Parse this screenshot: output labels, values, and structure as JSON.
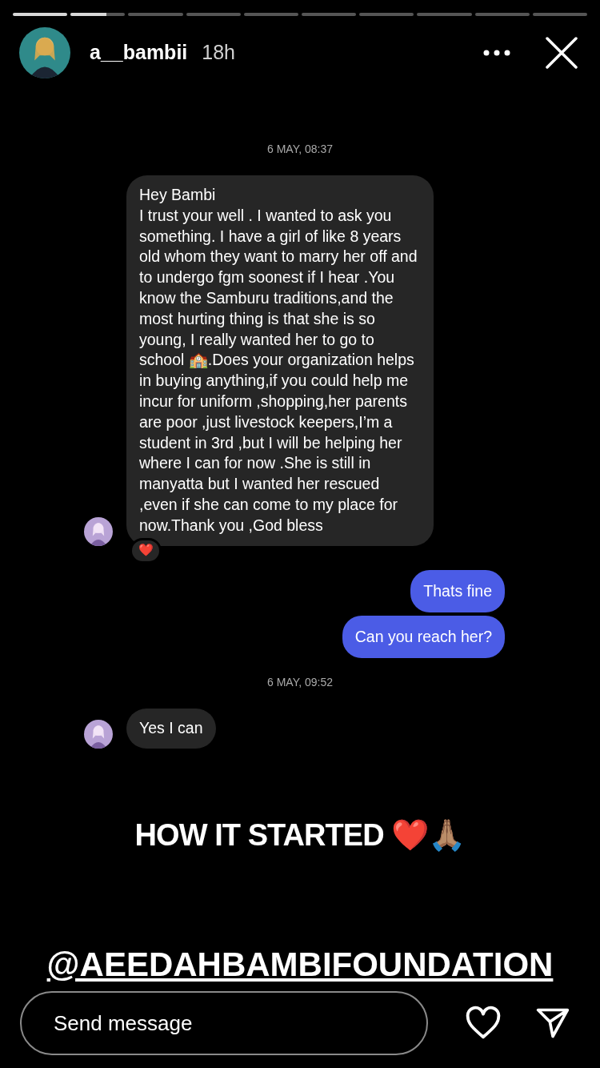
{
  "progress": [
    {
      "level": 1
    },
    {
      "level": 0.65
    },
    {
      "level": 0
    },
    {
      "level": 0
    },
    {
      "level": 0
    },
    {
      "level": 0
    },
    {
      "level": 0
    },
    {
      "level": 0
    },
    {
      "level": 0
    },
    {
      "level": 0
    }
  ],
  "header": {
    "username": "a__bambii",
    "time": "18h"
  },
  "chat": [
    {
      "kind": "date",
      "text": "6 MAY, 08:37"
    },
    {
      "kind": "incoming",
      "text": "Hey Bambi\nI trust your well . I wanted to ask you something. I have a girl of like 8 years old whom they want to marry her off and to undergo fgm  soonest if I hear .You know the Samburu traditions,and the most hurting thing is that she is so young, I really wanted her to go to school 🏫.Does your organization helps in buying anything,if you could help me incur for uniform ,shopping,her parents are poor ,just livestock keepers,I’m a student in 3rd ,but I will be helping her where I can for now .She is still in manyatta but I wanted her rescued ,even if she can come to my place for now.Thank you ,God bless",
      "reaction": "❤️"
    },
    {
      "kind": "outgoing",
      "text": "Thats fine"
    },
    {
      "kind": "outgoing",
      "text": "Can you reach her?"
    },
    {
      "kind": "date",
      "text": "6 MAY, 09:52"
    },
    {
      "kind": "incoming",
      "text": "Yes I can"
    }
  ],
  "caption": "HOW IT STARTED ❤️🙏🏽",
  "mention": "@AEEDAHBAMBIFOUNDATION",
  "reply": {
    "placeholder": "Send message"
  }
}
